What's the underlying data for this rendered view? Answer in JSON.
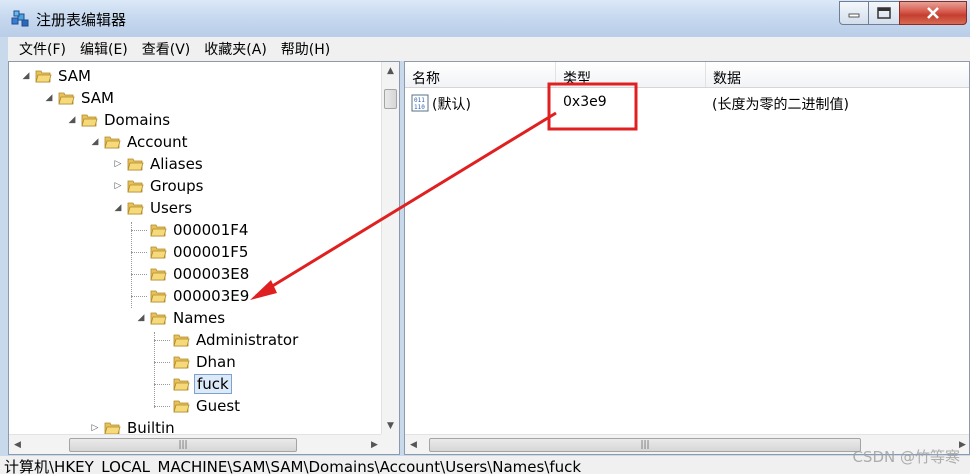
{
  "window": {
    "title": "注册表编辑器"
  },
  "menu": [
    "文件(F)",
    "编辑(E)",
    "查看(V)",
    "收藏夹(A)",
    "帮助(H)"
  ],
  "tree": [
    {
      "label": "SAM",
      "toggle": "open"
    },
    {
      "label": "SAM",
      "toggle": "open"
    },
    {
      "label": "Domains",
      "toggle": "open"
    },
    {
      "label": "Account",
      "toggle": "open"
    },
    {
      "label": "Aliases",
      "toggle": "closed"
    },
    {
      "label": "Groups",
      "toggle": "closed"
    },
    {
      "label": "Users",
      "toggle": "open"
    },
    {
      "label": "000001F4",
      "toggle": "none"
    },
    {
      "label": "000001F5",
      "toggle": "none"
    },
    {
      "label": "000003E8",
      "toggle": "none"
    },
    {
      "label": "000003E9",
      "toggle": "none"
    },
    {
      "label": "Names",
      "toggle": "open"
    },
    {
      "label": "Administrator",
      "toggle": "none"
    },
    {
      "label": "Dhan",
      "toggle": "none"
    },
    {
      "label": "fuck",
      "toggle": "none",
      "selected": true
    },
    {
      "label": "Guest",
      "toggle": "none"
    },
    {
      "label": "Builtin",
      "toggle": "closed"
    }
  ],
  "list": {
    "columns": [
      "名称",
      "类型",
      "数据"
    ],
    "rows": [
      {
        "name": "(默认)",
        "type": "0x3e9",
        "data": "(长度为零的二进制值)"
      }
    ]
  },
  "status": "计算机\\HKEY_LOCAL_MACHINE\\SAM\\SAM\\Domains\\Account\\Users\\Names\\fuck",
  "watermark": "CSDN @竹等寒",
  "colors": {
    "annotation": "#e02020",
    "selection": "#dce9f8",
    "folder": "#e8c15a"
  },
  "scroll_glyph": "|||"
}
